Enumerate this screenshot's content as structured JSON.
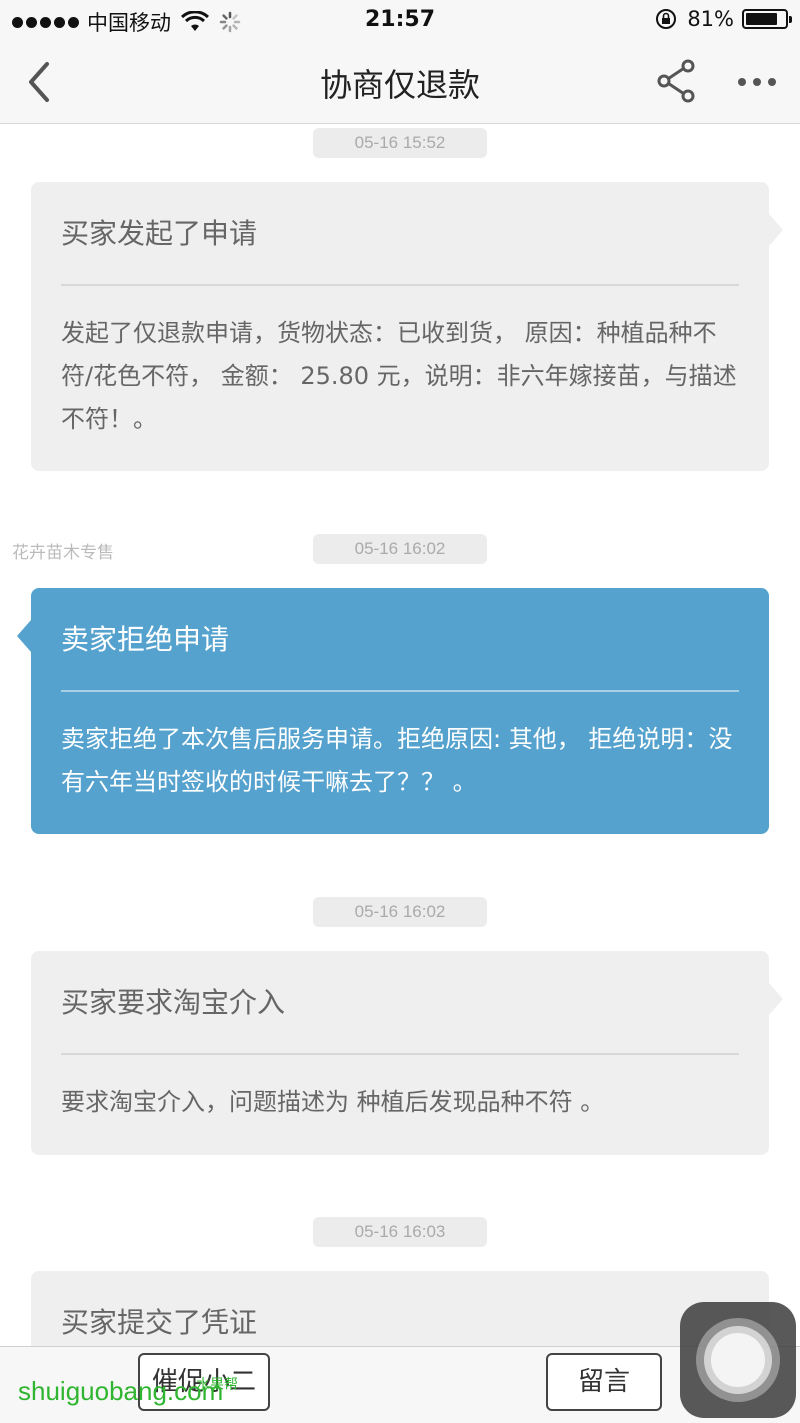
{
  "status_bar": {
    "carrier": "中国移动",
    "time": "21:57",
    "battery": "81%",
    "battery_level": 0.81,
    "icons": [
      "signal-icon",
      "wifi-icon",
      "loading-icon",
      "orientation-lock-icon",
      "battery-icon"
    ]
  },
  "nav": {
    "title": "协商仅退款",
    "icons": [
      "back-chevron-icon",
      "share-icon",
      "more-icon"
    ]
  },
  "messages": [
    {
      "time": "05-16 15:52",
      "title": "买家发起了申请",
      "body": "发起了仅退款申请，货物状态：已收到货， 原因：种植品种不符/花色不符， 金额： 25.80 元，说明：非六年嫁接苗，与描述不符！。"
    },
    {
      "sender": "花卉苗木专售",
      "time": "05-16 16:02",
      "title": "卖家拒绝申请",
      "body": "卖家拒绝了本次售后服务申请。拒绝原因: 其他， 拒绝说明：没有六年当时签收的时候干嘛去了？？ 。"
    },
    {
      "time": "05-16 16:02",
      "title": "买家要求淘宝介入",
      "body": "要求淘宝介入，问题描述为 种植后发现品种不符 。"
    },
    {
      "time": "05-16 16:03",
      "title": "买家提交了凭证"
    }
  ],
  "bottom_bar": {
    "urge_label": "催促小二",
    "comment_label": "留言"
  },
  "watermark": {
    "text": "shuiguobang.com",
    "small": "水果帮"
  },
  "colors": {
    "seller_card": "#55a2ce",
    "buyer_card": "#efefef",
    "watermark": "#2fb52f"
  }
}
